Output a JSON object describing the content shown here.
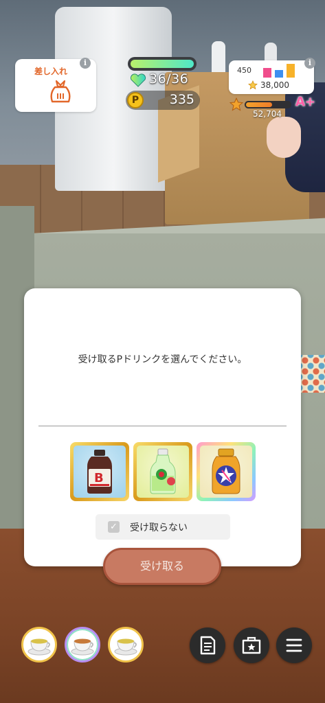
{
  "hud": {
    "gift_label": "差し入れ",
    "stamina_text": "36/36",
    "stamina_fraction": 1.0,
    "pcoin_label": "P",
    "pcoin_text": "335",
    "fan_count": "450",
    "fan_total": "38,000",
    "rank_score": "52,704",
    "rank_progress": 0.6,
    "rank_grade": "A+"
  },
  "modal": {
    "message": "受け取るPドリンクを選んでください。",
    "drinks": [
      {
        "name": "bottle-b-drink-icon",
        "frame": "gold"
      },
      {
        "name": "bottle-green-drink-icon",
        "frame": "gold"
      },
      {
        "name": "bottle-star-drink-icon",
        "frame": "rainbow"
      }
    ],
    "skip_label": "受け取らない",
    "skip_check_glyph": "✓"
  },
  "receive_button_label": "受け取る",
  "bottom_bar": {
    "items": [
      {
        "name": "tea-cup-item-icon",
        "frame": "gold"
      },
      {
        "name": "tea-cup-item-icon",
        "frame": "rainbow"
      },
      {
        "name": "tea-cup-item-icon",
        "frame": "gold"
      }
    ],
    "buttons": [
      "memo-icon",
      "item-box-icon",
      "menu-icon"
    ]
  },
  "colors": {
    "accent_orange": "#e2672a",
    "button_disabled": "#c87a62"
  }
}
